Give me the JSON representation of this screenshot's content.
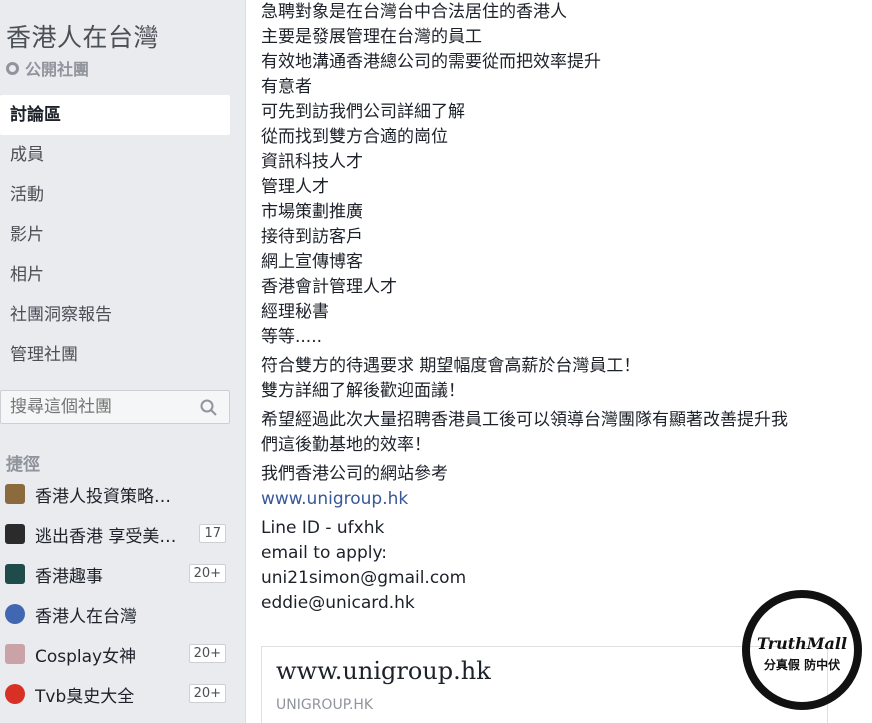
{
  "group": {
    "title": "香港人在台灣",
    "type": "公開社團"
  },
  "nav": [
    {
      "label": "討論區",
      "active": true
    },
    {
      "label": "成員"
    },
    {
      "label": "活動"
    },
    {
      "label": "影片"
    },
    {
      "label": "相片"
    },
    {
      "label": "社團洞察報告"
    },
    {
      "label": "管理社團"
    }
  ],
  "search": {
    "placeholder": "搜尋這個社團"
  },
  "shortcuts": {
    "heading": "捷徑",
    "items": [
      {
        "label": "香港人投資策略討論",
        "badge": "",
        "color": "#8b6b3e"
      },
      {
        "label": "逃出香港 享受美…",
        "badge": "17",
        "color": "#2b2b2b"
      },
      {
        "label": "香港趣事",
        "badge": "20+",
        "color": "#1f4c4a"
      },
      {
        "label": "香港人在台灣",
        "badge": "",
        "color": "#4267b2"
      },
      {
        "label": "Cosplay女神",
        "badge": "20+",
        "color": "#c9a3a8"
      },
      {
        "label": "Tvb臭史大全",
        "badge": "20+",
        "color": "#d93025"
      }
    ]
  },
  "post": {
    "lines_block1": [
      "急聘對象是在台灣台中合法居住的香港人",
      "主要是發展管理在台灣的員工",
      "有效地溝通香港總公司的需要從而把效率提升",
      "有意者",
      "可先到訪我們公司詳細了解",
      "從而找到雙方合適的崗位",
      "資訊科技人才",
      "管理人才",
      "市場策劃推廣",
      "接待到訪客戶",
      "網上宣傳博客",
      "香港會計管理人才",
      "經理秘書",
      "等等....."
    ],
    "lines_block2": [
      "符合雙方的待遇要求 期望幅度會高薪於台灣員工！",
      "雙方詳細了解後歡迎面議！"
    ],
    "lines_block3": [
      "希望經過此次大量招聘香港員工後可以領導台灣團隊有顯著改善提升我",
      "們這後勤基地的效率！"
    ],
    "website_intro": "我們香港公司的網站參考",
    "website_link": "www.unigroup.hk",
    "contact_lines": [
      "Line ID - ufxhk",
      "email to apply:",
      "uni21simon@gmail.com",
      "eddie@unicard.hk"
    ]
  },
  "link_preview": {
    "title": "www.unigroup.hk",
    "domain": "UNIGROUP.HK"
  },
  "watermark": {
    "title": "TruthMall",
    "subtitle": "分真假 防中伏"
  }
}
